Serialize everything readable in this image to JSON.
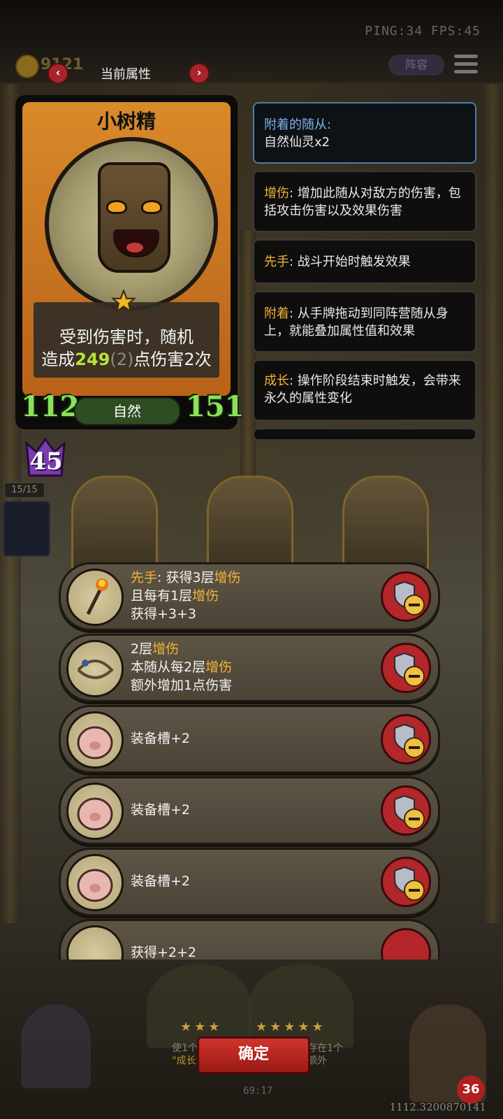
{
  "hud": {
    "ping_fps": "PING:34  FPS:45",
    "gold": "9121",
    "lineup_label": "阵容"
  },
  "header": {
    "title": "当前属性",
    "prev_arrow": "‹",
    "next_arrow": "›"
  },
  "card": {
    "name": "小树精",
    "desc_line1": "受到伤害时，随机",
    "desc_prefix": "造成",
    "desc_damage": "249",
    "desc_paren": "(2)",
    "desc_suffix": "点伤害2次",
    "attack": "112",
    "type": "自然",
    "health": "151",
    "level": "45",
    "count": "15/15"
  },
  "tooltips": [
    {
      "keyword": "附着的随从:",
      "text": "自然仙灵x2"
    },
    {
      "keyword": "增伤",
      "text": ": 增加此随从对敌方的伤害，包括攻击伤害以及效果伤害"
    },
    {
      "keyword": "先手",
      "text": ": 战斗开始时触发效果"
    },
    {
      "keyword": "附着",
      "text": ": 从手牌拖动到同阵营随从身上，就能叠加属性值和效果"
    },
    {
      "keyword": "成长",
      "text": ": 操作阶段结束时触发，会带来永久的属性变化"
    }
  ],
  "items": [
    {
      "line1a": "先手",
      "line1b": ": 获得3层",
      "line1c": "增伤",
      "line2a": "且每有1层",
      "line2b": "增伤",
      "line3": "获得+3+3",
      "icon": "torch-icon"
    },
    {
      "line1a": "2层",
      "line1b": "增伤",
      "line2a": "本随从每2层",
      "line2b": "增伤",
      "line3": "额外增加1点伤害",
      "icon": "rope-icon"
    },
    {
      "text": "装备槽+2",
      "icon": "pig-icon"
    },
    {
      "text": "装备槽+2",
      "icon": "pig-icon"
    },
    {
      "text": "装备槽+2",
      "icon": "pig-icon"
    },
    {
      "text": "获得+2+2",
      "icon": "crown-icon"
    }
  ],
  "bottom": {
    "confirm": "确定",
    "hint_left_1": "使1个",
    "hint_left_2": "\"成长\"",
    "hint_right_1": "存在1个",
    "hint_right_2": "额外",
    "timer": "69:17",
    "build": "1112.3200870141",
    "badge": "36"
  },
  "colors": {
    "accent_red": "#b3262a",
    "keyword": "#f2b436",
    "stat_green": "#8ee05a",
    "card_orange": "#d98a2a"
  }
}
